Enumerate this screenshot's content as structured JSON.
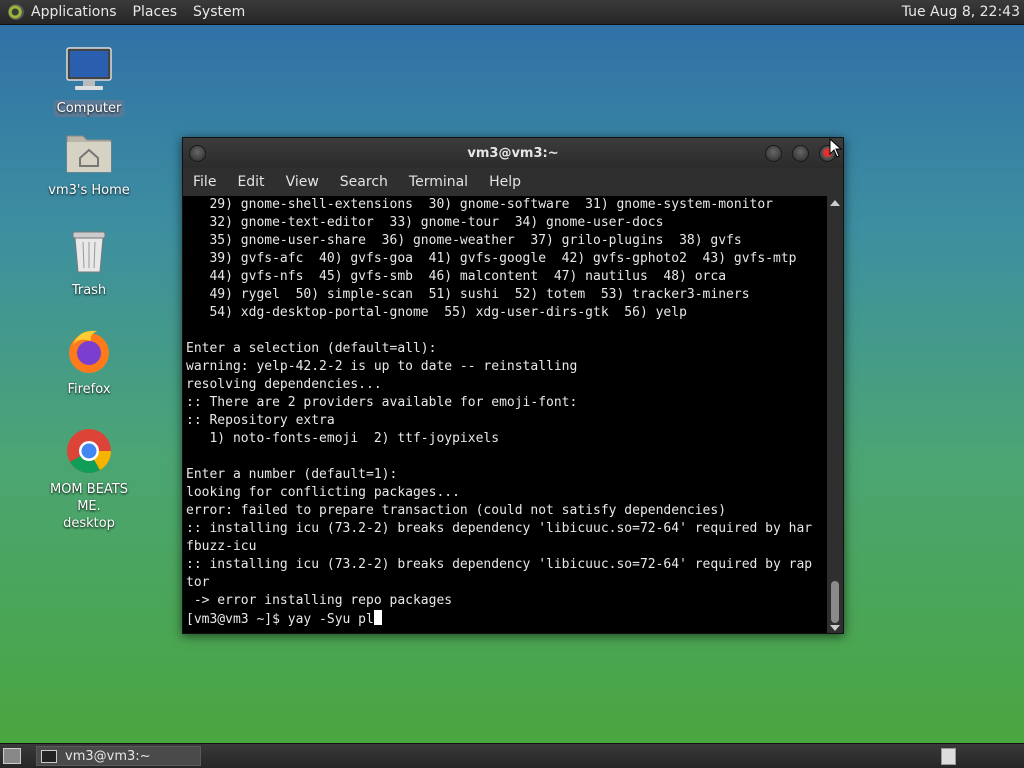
{
  "top_panel": {
    "menus": [
      "Applications",
      "Places",
      "System"
    ],
    "clock": "Tue Aug  8, 22:43"
  },
  "desktop_icons": {
    "computer": "Computer",
    "home": "vm3's Home",
    "trash": "Trash",
    "firefox": "Firefox",
    "chrome_line1": "MOM BEATS ME.",
    "chrome_line2": "desktop"
  },
  "terminal": {
    "title": "vm3@vm3:~",
    "menus": [
      "File",
      "Edit",
      "View",
      "Search",
      "Terminal",
      "Help"
    ],
    "lines": [
      "   29) gnome-shell-extensions  30) gnome-software  31) gnome-system-monitor",
      "   32) gnome-text-editor  33) gnome-tour  34) gnome-user-docs",
      "   35) gnome-user-share  36) gnome-weather  37) grilo-plugins  38) gvfs",
      "   39) gvfs-afc  40) gvfs-goa  41) gvfs-google  42) gvfs-gphoto2  43) gvfs-mtp",
      "   44) gvfs-nfs  45) gvfs-smb  46) malcontent  47) nautilus  48) orca",
      "   49) rygel  50) simple-scan  51) sushi  52) totem  53) tracker3-miners",
      "   54) xdg-desktop-portal-gnome  55) xdg-user-dirs-gtk  56) yelp",
      "",
      "Enter a selection (default=all):",
      "warning: yelp-42.2-2 is up to date -- reinstalling",
      "resolving dependencies...",
      ":: There are 2 providers available for emoji-font:",
      ":: Repository extra",
      "   1) noto-fonts-emoji  2) ttf-joypixels",
      "",
      "Enter a number (default=1):",
      "looking for conflicting packages...",
      "error: failed to prepare transaction (could not satisfy dependencies)",
      ":: installing icu (73.2-2) breaks dependency 'libicuuc.so=72-64' required by har",
      "fbuzz-icu",
      ":: installing icu (73.2-2) breaks dependency 'libicuuc.so=72-64' required by rap",
      "tor",
      " -> error installing repo packages"
    ],
    "prompt": "[vm3@vm3 ~]$ yay -Syu pl"
  },
  "bottom_panel": {
    "task_label": "vm3@vm3:~"
  }
}
